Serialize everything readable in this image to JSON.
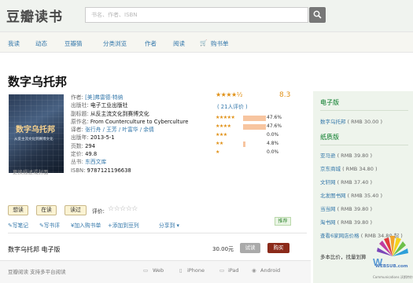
{
  "header": {
    "logo": "豆瓣读书",
    "search_placeholder": "书名、作者、ISBN"
  },
  "nav": {
    "items": [
      "我读",
      "动态",
      "豆瓣猜",
      "分类浏览",
      "作者",
      "阅读",
      "购书单"
    ]
  },
  "book": {
    "title": "数字乌托邦",
    "cover": {
      "title": "数字乌托邦",
      "subtitle": "从反主流文化到赛博文化"
    },
    "cover_link": "更换描述或封面",
    "info": [
      {
        "k": "作者:",
        "v": "[美]弗雷德·特纳",
        "link": true
      },
      {
        "k": "出版社:",
        "v": "电子工业出版社",
        "link": false
      },
      {
        "k": "副标题:",
        "v": "从反主流文化到赛博文化",
        "link": false
      },
      {
        "k": "原作名:",
        "v": "From Counterculture to Cyberculture",
        "link": false
      },
      {
        "k": "译者:",
        "v": "张行舟 / 王芳 / 叶富华 / 余倩",
        "link": true
      },
      {
        "k": "出版年:",
        "v": "2013-5-1",
        "link": false
      },
      {
        "k": "页数:",
        "v": "294",
        "link": false
      },
      {
        "k": "定价:",
        "v": "49.8",
        "link": false
      },
      {
        "k": "丛书:",
        "v": "东西文库",
        "link": true
      },
      {
        "k": "ISBN:",
        "v": "9787121196638",
        "link": false
      }
    ]
  },
  "rating": {
    "stars": "★★★★½",
    "score": "8.3",
    "count": "( 21人评价 )",
    "breakdown": [
      {
        "stars": "★★★★★",
        "pct": "47.6%",
        "value": 0.476
      },
      {
        "stars": "★★★★",
        "pct": "47.6%",
        "value": 0.476
      },
      {
        "stars": "★★★",
        "pct": "0.0%",
        "value": 0.0
      },
      {
        "stars": "★★",
        "pct": "4.8%",
        "value": 0.048
      },
      {
        "stars": "★",
        "pct": "0.0%",
        "value": 0.0
      }
    ]
  },
  "tags": {
    "want": "想读",
    "reading": "在读",
    "read": "读过",
    "rate_label": "评价:",
    "rate_stars": "☆☆☆☆☆"
  },
  "actions": {
    "write_note": "✎写笔记",
    "write_review": "✎写书评",
    "add_list": "¥加入购书单",
    "add_doulist": "+添加到豆列",
    "share": "分享到 ▾",
    "recommend": "推荐"
  },
  "ebook": {
    "title": "数字乌托邦 电子版",
    "price": "30.00元",
    "try": "试读",
    "buy": "购买"
  },
  "platforms": {
    "intro": "豆瓣阅读 支持多平台阅读",
    "items": [
      "Web",
      "iPhone",
      "iPad",
      "Android"
    ]
  },
  "side": {
    "ebook_heading": "电子版",
    "ebook_item": {
      "name": "数字乌托邦",
      "price": "( RMB 30.00 )"
    },
    "paper_heading": "纸质版",
    "stores": [
      {
        "name": "亚马逊",
        "price": "( RMB 39.80 )"
      },
      {
        "name": "京东商城",
        "price": "( RMB 34.80 )"
      },
      {
        "name": "文轩网",
        "price": "( RMB 37.40 )"
      },
      {
        "name": "北发图书网",
        "price": "( RMB 35.40 )"
      },
      {
        "name": "当当网",
        "price": "( RMB 39.80 )"
      },
      {
        "name": "淘书网",
        "price": "( RMB 39.80 )"
      },
      {
        "name": "查看6家网店价格",
        "price": "( RMB 34.80 起 )"
      }
    ],
    "compare": "多本比价，找量划算"
  },
  "watermark": {
    "brand": "WEBSUB.com",
    "caption": "Communications 沃斯特尔"
  }
}
